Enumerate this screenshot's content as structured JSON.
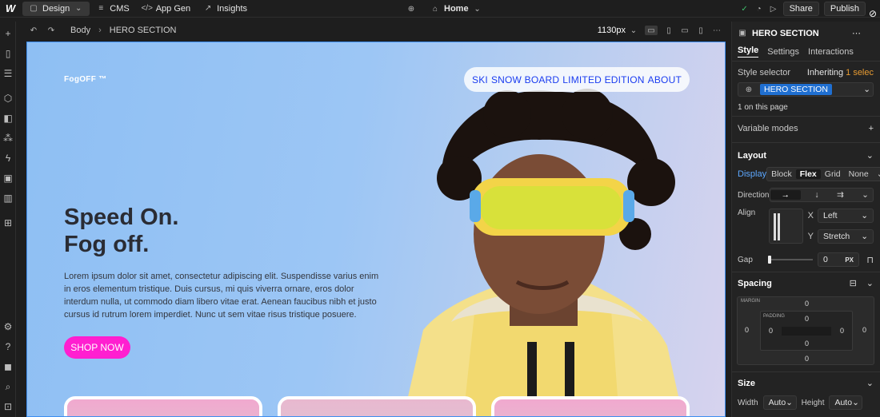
{
  "topbar": {
    "logo": "W",
    "design_label": "Design",
    "cms_label": "CMS",
    "appgen_label": "App Gen",
    "insights_label": "Insights",
    "home_label": "Home",
    "share_label": "Share",
    "publish_label": "Publish"
  },
  "subbar": {
    "breadcrumb_body": "Body",
    "breadcrumb_section": "HERO SECTION",
    "width_label": "1130px"
  },
  "canvas": {
    "brand": "FogOFF ™",
    "nav": [
      "SKI",
      "SNOW BOARD",
      "LIMITED EDITION",
      "ABOUT"
    ],
    "headline_line1": "Speed On.",
    "headline_line2": "Fog off.",
    "body": "Lorem ipsum dolor sit amet, consectetur adipiscing elit. Suspendisse varius enim in eros elementum tristique. Duis cursus, mi quis viverra ornare, eros dolor interdum nulla, ut commodo diam libero vitae erat. Aenean faucibus nibh et justo cursus id rutrum lorem imperdiet. Nunc ut sem vitae risus tristique posuere.",
    "cta": "SHOP NOW",
    "accent_color": "#ff1fd0",
    "nav_color": "#1a3cf0"
  },
  "panel": {
    "element_name": "HERO SECTION",
    "tabs": [
      "Style",
      "Settings",
      "Interactions"
    ],
    "style_selector_label": "Style selector",
    "inheriting_label": "Inheriting",
    "inheriting_count": "1 selec",
    "selector_chip": "HERO SECTION",
    "on_page": "1 on this page",
    "variable_modes": "Variable modes",
    "layout_title": "Layout",
    "display_label": "Display",
    "display_options": [
      "Block",
      "Flex",
      "Grid",
      "None"
    ],
    "direction_label": "Direction",
    "align_label": "Align",
    "align_x_axis": "X",
    "align_x_value": "Left",
    "align_y_axis": "Y",
    "align_y_value": "Stretch",
    "gap_label": "Gap",
    "gap_value": "0",
    "gap_unit": "PX",
    "spacing_title": "Spacing",
    "margin_label": "MARGIN",
    "padding_label": "PADDING",
    "spacing_values": {
      "m_top": "0",
      "m_left": "0",
      "m_right": "0",
      "m_bottom": "0",
      "p_top": "0",
      "p_left": "0",
      "p_right": "0",
      "p_bottom": "0"
    },
    "size_title": "Size",
    "width_label": "Width",
    "width_value": "Auto",
    "height_label": "Height",
    "height_value": "Auto"
  }
}
